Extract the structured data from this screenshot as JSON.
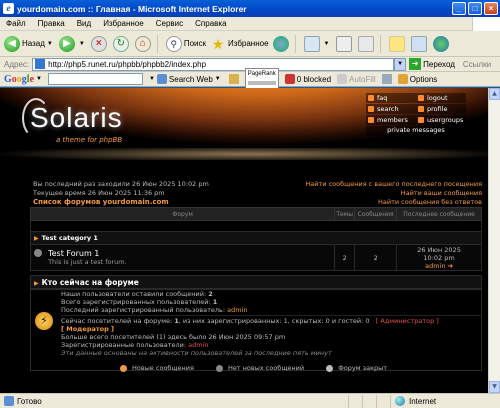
{
  "window": {
    "title": "yourdomain.com :: Главная - Microsoft Internet Explorer",
    "app_icon_letter": "e",
    "minimize": "_",
    "maximize": "□",
    "close": "×"
  },
  "menu": [
    "Файл",
    "Правка",
    "Вид",
    "Избранное",
    "Сервис",
    "Справка"
  ],
  "toolbar": {
    "back_label": "Назад",
    "search_label": "Поиск",
    "favorites_label": "Избранное"
  },
  "address": {
    "label": "Адрес:",
    "url": "http://php5.runet.ru/phpbb/phpbb2/index.php",
    "go_label": "Переход",
    "links_label": "Ссылки"
  },
  "google_bar": {
    "search_web": "Search Web",
    "pagerank": "PageRank",
    "blocked": "0 blocked",
    "autofill": "AutoFill",
    "options": "Options"
  },
  "header": {
    "logo": "Solaris",
    "tagline": "a theme for phpBB",
    "nav": [
      {
        "label": "faq"
      },
      {
        "label": "logout"
      },
      {
        "label": "search"
      },
      {
        "label": "profile"
      },
      {
        "label": "members"
      },
      {
        "label": "usergroups"
      }
    ],
    "private_messages": "private messages"
  },
  "info": {
    "last_visit": "Вы последний раз заходили 26 Июн 2025 10:02 pm",
    "current_time": "Текущее время 26 Июн 2025 11:36 pm",
    "forum_index": "Список форумов yourdomain.com"
  },
  "right_links": [
    "Найти сообщения с вашего последнего посещения",
    "Найти ваши сообщения",
    "Найти сообщения без ответов"
  ],
  "forum_table": {
    "headers": {
      "forum": "Форум",
      "topics": "Темы",
      "posts": "Сообщения",
      "last_post": "Последнее сообщение"
    },
    "category": "Test category 1",
    "forums": [
      {
        "name": "Test Forum 1",
        "desc": "This is just a test forum.",
        "topics": "2",
        "posts": "2",
        "last_date": "26 Июн 2025",
        "last_time": "10:02 pm",
        "last_user": "admin"
      }
    ]
  },
  "who": {
    "title": "Кто сейчас на форуме",
    "bolt": "⚡",
    "total_posts_label": "Наши пользователи оставили сообщений:",
    "total_posts": "2",
    "total_users_label": "Всего зарегистрированных пользователей:",
    "total_users": "1",
    "newest_label": "Последний зарегистрированный пользователь:",
    "newest_user": "admin",
    "online_line_a": "Сейчас посетителей на форуме:",
    "online_line_b": "1",
    "online_line_c": ", из них зарегистрированных: 1, скрытых: 0 и гостей: 0",
    "admin_tag": "[ Администратор ]",
    "mod_tag": "[ Модератор ]",
    "record_line": "Больше всего посетителей (1) здесь было 26 Июн 2025 09:57 pm",
    "registered_label": "Зарегистрированные пользователи:",
    "registered_user": "admin",
    "note": "Эти данные основаны на активности пользователей за последние пять минут"
  },
  "legend": [
    {
      "label": "Новые сообщения",
      "color": "#f39a40"
    },
    {
      "label": "Нет новых сообщений",
      "color": "#888888"
    },
    {
      "label": "Форум закрыт",
      "color": "#bbbbbb"
    }
  ],
  "status": {
    "text": "Готово",
    "zone": "Internet"
  }
}
